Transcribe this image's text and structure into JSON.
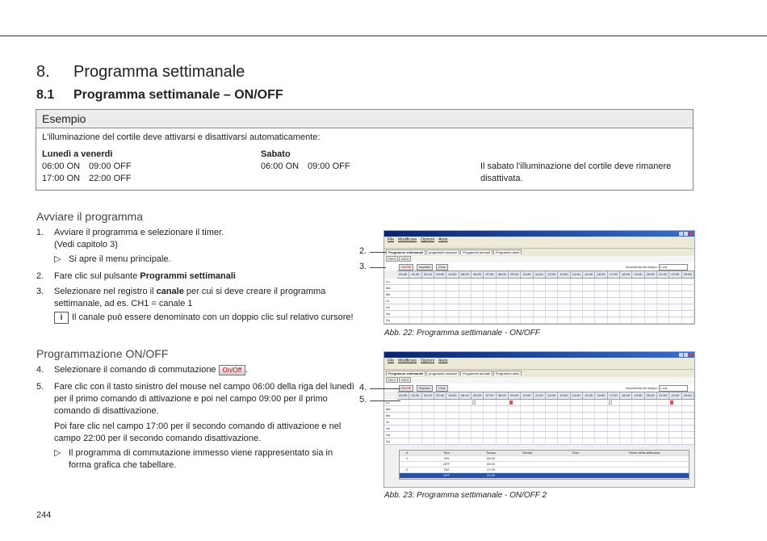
{
  "chapter": {
    "number": "8.",
    "title": "Programma settimanale"
  },
  "section": {
    "number": "8.1",
    "title": "Programma settimanale – ON/OFF"
  },
  "example": {
    "title": "Esempio",
    "intro": "L'illuminazione del cortile deve attivarsi e disattivarsi automaticamente:",
    "weekdays": {
      "label": "Lunedì a venerdì",
      "rows": [
        [
          "06:00 ON",
          "09:00 OFF"
        ],
        [
          "17:00 ON",
          "22:00 OFF"
        ]
      ]
    },
    "saturday": {
      "label": "Sabato",
      "rows": [
        [
          "06:00 ON",
          "09:00 OFF"
        ]
      ]
    },
    "note": "Il sabato l'illuminazione del cortile deve rimanere disattivata."
  },
  "start": {
    "title": "Avviare il programma",
    "steps": [
      {
        "n": "1.",
        "text": "Avviare il programma e selezionare il timer.",
        "text2": "(Vedi capitolo 3)",
        "sub": "Si apre il menu principale."
      },
      {
        "n": "2.",
        "pre": "Fare clic sul pulsante ",
        "bold": "Programmi settimanali",
        "post": ""
      },
      {
        "n": "3.",
        "pre": "Selezionare nel registro il ",
        "bold": "canale",
        "post": " per cui si deve creare il programma settimanale, ad es. CH1 = canale 1",
        "info": "Il canale può essere denominato con un doppio clic sul relativo cursore!"
      }
    ]
  },
  "programming": {
    "title": "Programmazione ON/OFF",
    "step4": {
      "n": "4.",
      "text": "Selezionare il comando di commutazione",
      "button": "On/Off",
      "end": "."
    },
    "step5": {
      "n": "5.",
      "text": "Fare clic con il tasto sinistro del mouse nel campo 06:00 della riga del lunedì per il primo comando di attivazione e poi nel campo 09:00 per il primo comando di disattivazione.",
      "text2": "Poi fare clic nel campo 17:00 per il secondo comando di attivazione e nel campo 22:00 per il secondo comando disattivazione.",
      "sub": "Il programma di commutazione immesso viene rappresentato sia in forma grafica che tabellare."
    }
  },
  "screenshot": {
    "menu": [
      "File",
      "Modificare",
      "Opzioni",
      "Aiuto"
    ],
    "tabs": [
      "Programmi settimanali",
      "programmi vacanze",
      "Programmi annuali",
      "Programmi astro"
    ],
    "tabs2": [
      "Programmi settimanali",
      "programmi vacanze",
      "Programmi annuali",
      "Programmi astro"
    ],
    "channels": [
      "CH 1",
      "CH 2"
    ],
    "buttons": [
      "On/Off",
      "Impulso",
      "Ciclo"
    ],
    "increment_label": "Incremento del tempo:",
    "increment_value": "1 ora",
    "hours": [
      "00:00",
      "01:00",
      "02:00",
      "03:00",
      "04:00",
      "05:00",
      "06:00",
      "07:00",
      "08:00",
      "09:00",
      "10:00",
      "11:00",
      "12:00",
      "13:00",
      "14:00",
      "15:00",
      "16:00",
      "17:00",
      "18:00",
      "19:00",
      "20:00",
      "21:00",
      "22:00",
      "23:00"
    ],
    "days": [
      "Lu",
      "Ma",
      "Me",
      "Gi",
      "Ve",
      "Sa",
      "Do"
    ],
    "table_headers": [
      "#",
      "Tipo",
      "Tempo",
      "Durata",
      "Ciclo",
      "Giorni della settimana"
    ],
    "table_rows": [
      {
        "n": "1",
        "type": "ON",
        "time": "06:00"
      },
      {
        "n": "",
        "type": "OFF",
        "time": "09:00"
      },
      {
        "n": "2",
        "type": "ON",
        "time": "17:00"
      },
      {
        "n": "",
        "type": "OFF",
        "time": "22:00"
      }
    ]
  },
  "callouts": [
    "2.",
    "3.",
    "4.",
    "5."
  ],
  "captions": [
    "Abb. 22:  Programma settimanale - ON/OFF",
    "Abb. 23:  Programma settimanale - ON/OFF 2"
  ],
  "page_number": "244"
}
